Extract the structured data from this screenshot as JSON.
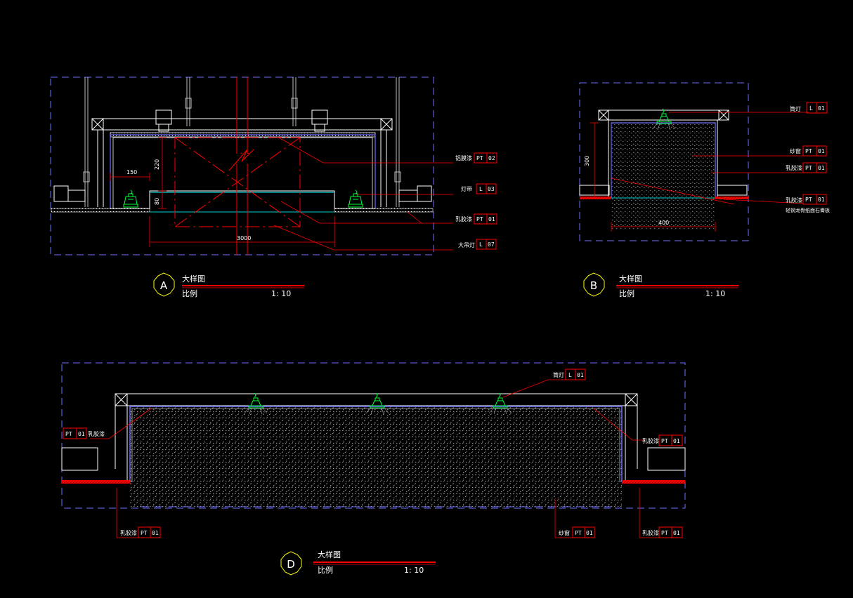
{
  "colors": {
    "background": "#000000",
    "line_white": "#ffffff",
    "line_red": "#ff0000",
    "line_blue": "#6f6fff",
    "fixture_green": "#00ff3c",
    "line_cyan": "#00cccc",
    "title_yellow": "#ffff00"
  },
  "detail_a": {
    "title": {
      "id": "A",
      "name": "大样图",
      "scale_label": "比例",
      "scale_value": "1: 10"
    },
    "dims": {
      "d150": "150",
      "d220": "220",
      "d80": "80",
      "d3000": "3000"
    },
    "callouts": [
      {
        "text": "铝膜漆",
        "code": "PT",
        "num": "02"
      },
      {
        "text": "灯带",
        "code": "L",
        "num": "03"
      },
      {
        "text": "乳胶漆",
        "code": "PT",
        "num": "01"
      },
      {
        "text": "大吊灯",
        "code": "L",
        "num": "07"
      }
    ]
  },
  "detail_b": {
    "title": {
      "id": "B",
      "name": "大样图",
      "scale_label": "比例",
      "scale_value": "1: 10"
    },
    "dims": {
      "d300": "300",
      "d400": "400"
    },
    "callouts": [
      {
        "text": "筒灯",
        "code": "L",
        "num": "01"
      },
      {
        "text": "纱窗",
        "code": "PT",
        "num": "01"
      },
      {
        "text": "乳胶漆",
        "code": "PT",
        "num": "01"
      },
      {
        "text": "乳胶漆",
        "code": "PT",
        "num": "01"
      }
    ],
    "note": "轻钢龙骨纸面石膏板"
  },
  "detail_d": {
    "title": {
      "id": "D",
      "name": "大样图",
      "scale_label": "比例",
      "scale_value": "1: 10"
    },
    "callouts": {
      "top": {
        "text": "筒灯",
        "code": "L",
        "num": "01"
      },
      "left": {
        "text": "乳胶漆",
        "code": "PT",
        "num": "01"
      },
      "right": {
        "text": "乳胶漆",
        "code": "PT",
        "num": "01"
      },
      "bottom_left": {
        "text": "乳胶漆",
        "code": "PT",
        "num": "01"
      },
      "bottom_mid": {
        "text": "纱窗",
        "code": "PT",
        "num": "01"
      },
      "bottom_right": {
        "text": "乳胶漆",
        "code": "PT",
        "num": "01"
      }
    }
  }
}
